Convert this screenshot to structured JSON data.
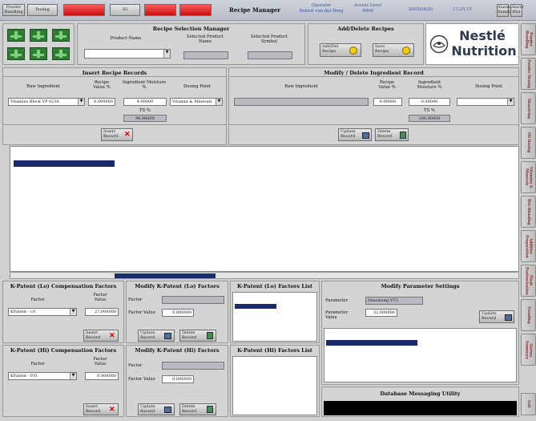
{
  "topbar": {
    "buttons": [
      "Powder Handling",
      "Dosing"
    ],
    "alarm_boxes": [
      "",
      "S3",
      "",
      ""
    ],
    "title": "Recipe Manager",
    "operator_label": "Operator",
    "operator_name": "Robert van der Berg",
    "access_label": "Access Level",
    "access_value": "9999",
    "date": "2005/04/03",
    "time": "11:25:15",
    "btn_a": "Alarm Summ",
    "btn_b": "Alarm Hist"
  },
  "recipe_selection": {
    "title": "Recipe Selection Manager",
    "product_name_label": "Product Name",
    "selected_product_name_label": "Selected Product Name",
    "selected_product_symbol_label": "Selected Product Symbol",
    "product_name_value": ""
  },
  "add_delete": {
    "title": "Add/Delete Recipes",
    "add_label": "Add/Del Recipe",
    "save_label": "Save Recipe"
  },
  "logo": {
    "top": "Nestlé",
    "bottom": "Nutrition"
  },
  "insert_records": {
    "title": "Insert Recipe Records",
    "col_raw": "Raw Ingredient",
    "col_value": "Recipe Value %",
    "col_moisture": "Ingredient Moisture %",
    "col_dosing": "Dosing Point",
    "raw_value": "Vitamins Block VP 0230",
    "recipe_value": "0.000000",
    "moisture_value": "4.00000",
    "dosing_value": "Vitamin & Minerals",
    "ts_label": "TS %",
    "ts_value": "96.00000",
    "insert_btn": "Insert Record"
  },
  "modify_records": {
    "title": "Modify / Delete Ingredient Record",
    "col_raw": "Raw Ingredient",
    "col_value": "Recipe Value %",
    "col_moisture": "Ingredient Moisture %",
    "col_dosing": "Dosing Point",
    "recipe_value": "0.00000",
    "moisture_value": "0.00000",
    "ts_label": "TS %",
    "ts_value": "100.00000",
    "update_btn": "Update Record",
    "delete_btn": "Delete Record"
  },
  "lo_comp": {
    "title": "K-Patent (Lo) Compensation Factors",
    "factor_label": "Factor",
    "value_label": "Factor Value",
    "factor_value": "KPatent - c0",
    "value_value": "27.000000",
    "insert_btn": "Insert Record"
  },
  "lo_modify": {
    "title": "Modify K-Patent (Lo) Factors",
    "factor_label": "Factor",
    "value_label": "Factor Value",
    "value_value": "0.000000",
    "update_btn": "Update Record",
    "delete_btn": "Delete Record"
  },
  "lo_list": {
    "title": "K-Patent (Lo) Factors List"
  },
  "hi_comp": {
    "title": "K-Patent (Hi) Compensation Factors",
    "factor_label": "Factor",
    "value_label": "Factor Value",
    "factor_value": "KPatent - P/0",
    "value_value": "0.000000",
    "insert_btn": "Insert Record"
  },
  "hi_modify": {
    "title": "Modify K-Patent (Hi) Factors",
    "factor_label": "Factor",
    "value_label": "Factor Value",
    "value_value": "0.000000",
    "update_btn": "Update Record",
    "delete_btn": "Delete Record"
  },
  "hi_list": {
    "title": "K-Patent (Hi) Factors List"
  },
  "param_settings": {
    "title": "Modify Parameter Settings",
    "param_label": "Parameter",
    "param_value": "Dissolving VT3",
    "pvalue_label": "Parameter Value",
    "pvalue_value": "32.000000",
    "update_btn": "Update Record"
  },
  "db_messaging": {
    "title": "Database Messaging Utility"
  },
  "right_tabs": [
    "Powder Handling",
    "Powder Dosing",
    "Dissolving",
    "Oil Dosing",
    "Vitamins & Minerals",
    "Wet Blending",
    "Additive Preparation",
    "Flash Pasteurisation",
    "Trending",
    "Alarms Summary",
    "Exit"
  ],
  "colors": {
    "accent": "#1b2a6b",
    "alarm_red": "#e02020",
    "panel": "#d4d4d4"
  }
}
